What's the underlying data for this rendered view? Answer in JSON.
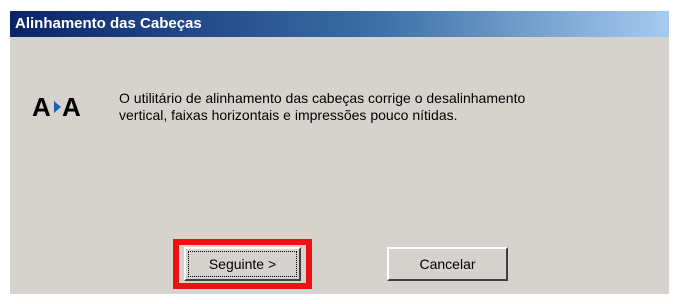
{
  "dialog": {
    "title": "Alinhamento das Cabeças",
    "icon": "head-alignment-icon",
    "message_line1": "O utilitário de alinhamento das cabeças corrige o desalinhamento",
    "message_line2": "vertical, faixas horizontais e impressões pouco nítidas.",
    "next_label": "Seguinte >",
    "cancel_label": "Cancelar"
  },
  "colors": {
    "title_bar_start": "#0a246a",
    "title_bar_end": "#a6caf0",
    "dialog_bg": "#d6d3ce",
    "highlight": "#ee1111"
  }
}
